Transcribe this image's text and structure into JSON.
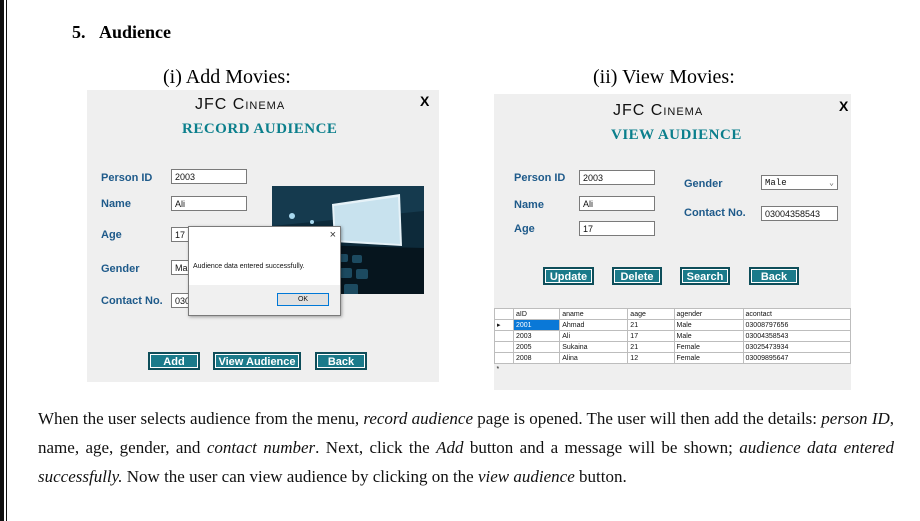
{
  "section": {
    "number": "5.",
    "title": "Audience"
  },
  "captions": {
    "left": "(i) Add Movies:",
    "right": "(ii) View Movies:"
  },
  "add_form": {
    "brand": "JFC Cinema",
    "subtitle": "RECORD AUDIENCE",
    "close": "X",
    "labels": {
      "person_id": "Person ID",
      "name": "Name",
      "age": "Age",
      "gender": "Gender",
      "contact": "Contact No."
    },
    "values": {
      "person_id": "2003",
      "name": "Ali",
      "age": "17",
      "gender": "Ma",
      "contact": "030"
    },
    "buttons": {
      "add": "Add",
      "view": "View Audience",
      "back": "Back"
    },
    "dialog": {
      "message": "Audience data entered successfully.",
      "ok": "OK",
      "close": "×"
    }
  },
  "view_form": {
    "brand": "JFC Cinema",
    "subtitle": "VIEW AUDIENCE",
    "close": "X",
    "labels": {
      "person_id": "Person ID",
      "name": "Name",
      "age": "Age",
      "gender": "Gender",
      "contact": "Contact No."
    },
    "values": {
      "person_id": "2003",
      "name": "Ali",
      "age": "17",
      "gender": "Male",
      "contact": "03004358543"
    },
    "buttons": {
      "update": "Update",
      "delete": "Delete",
      "search": "Search",
      "back": "Back"
    },
    "grid": {
      "columns": [
        "aID",
        "aname",
        "aage",
        "agender",
        "acontact"
      ],
      "rows": [
        [
          "2001",
          "Ahmad",
          "21",
          "Male",
          "03008797656"
        ],
        [
          "2003",
          "Ali",
          "17",
          "Male",
          "03004358543"
        ],
        [
          "2005",
          "Sukaina",
          "21",
          "Female",
          "03025473934"
        ],
        [
          "2008",
          "Alina",
          "12",
          "Female",
          "03009895647"
        ]
      ],
      "current_row_marker": "▸",
      "new_row_marker": "*"
    }
  },
  "paragraph": {
    "p1": "When the user selects audience from the menu, ",
    "i1": "record audience",
    "p2": " page is opened. The user will then add the details: ",
    "i2": "person ID",
    "p3": ", name, age, gender, and ",
    "i3": "contact number",
    "p4": ". Next, click the ",
    "i4": "Add",
    "p5": " button and a message will be shown; ",
    "i5": "audience data entered successfully.",
    "p6": " Now the user can view audience by clicking on the ",
    "i6": "view audience",
    "p7": " button."
  }
}
